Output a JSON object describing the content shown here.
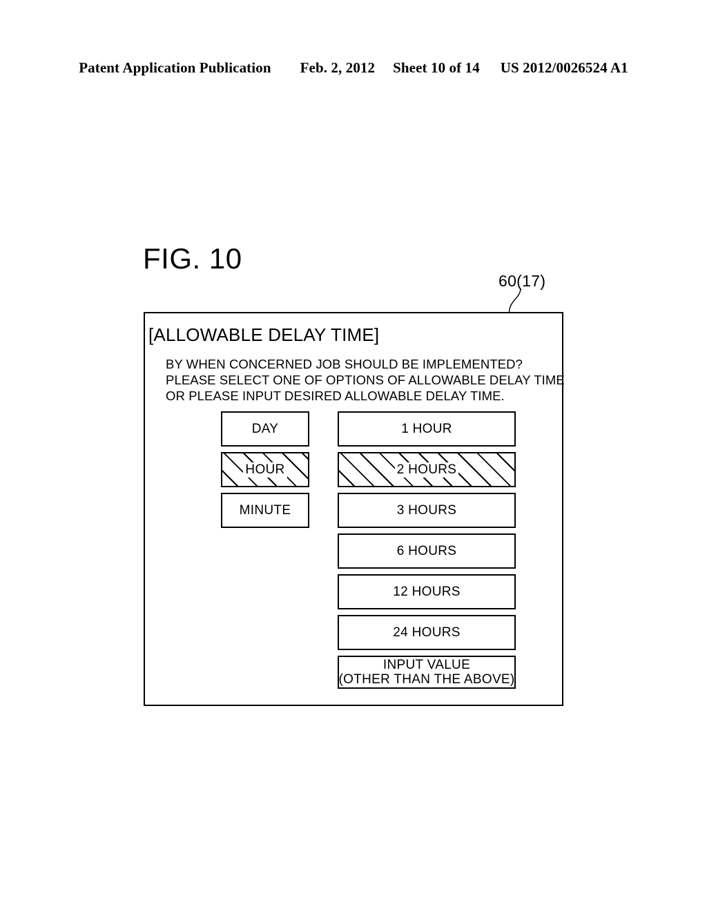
{
  "header": {
    "publication": "Patent Application Publication",
    "date": "Feb. 2, 2012",
    "sheet": "Sheet 10 of 14",
    "patent_number": "US 2012/0026524 A1"
  },
  "figure": {
    "title": "FIG. 10",
    "reference_label": "60(17)"
  },
  "panel": {
    "heading": "[ALLOWABLE DELAY TIME]",
    "instructions": [
      "BY WHEN CONCERNED JOB SHOULD BE IMPLEMENTED?",
      "PLEASE SELECT ONE OF OPTIONS OF ALLOWABLE DELAY TIME",
      "OR PLEASE INPUT DESIRED ALLOWABLE DELAY TIME."
    ],
    "unit_options": [
      {
        "label": "DAY",
        "selected": false
      },
      {
        "label": "HOUR",
        "selected": true
      },
      {
        "label": "MINUTE",
        "selected": false
      }
    ],
    "value_options": [
      {
        "label": "1 HOUR",
        "selected": false
      },
      {
        "label": "2 HOURS",
        "selected": true
      },
      {
        "label": "3 HOURS",
        "selected": false
      },
      {
        "label": "6 HOURS",
        "selected": false
      },
      {
        "label": "12 HOURS",
        "selected": false
      },
      {
        "label": "24 HOURS",
        "selected": false
      }
    ],
    "input_value_option": {
      "line1": "INPUT VALUE",
      "line2": "(OTHER THAN THE ABOVE)",
      "selected": false
    }
  },
  "colors": {
    "ink": "#000000",
    "paper": "#ffffff"
  }
}
